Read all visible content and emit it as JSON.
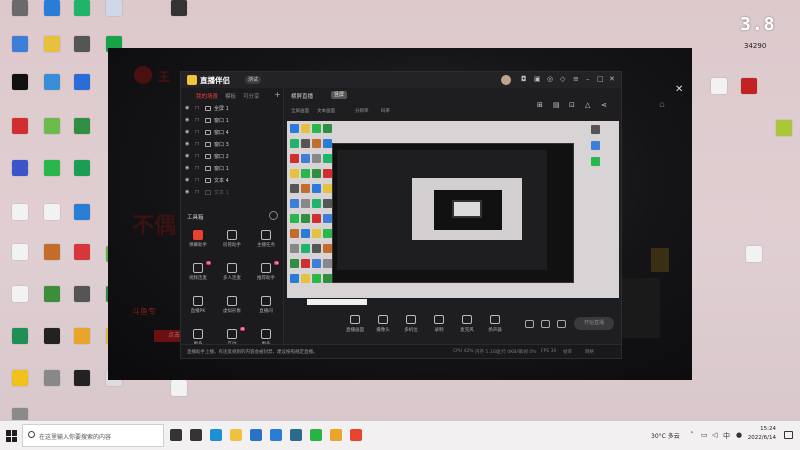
{
  "desktop_badge": {
    "big_text": "3.8",
    "small_text": "34290"
  },
  "desktop_icons": [
    {
      "label": "",
      "color": "#6a6a6a"
    },
    {
      "label": "",
      "color": "#2b7bd8"
    },
    {
      "label": "",
      "color": "#1fb46a"
    },
    {
      "label": "",
      "color": "#cfd8e6"
    },
    {
      "label": "",
      "color": "#333333"
    },
    {
      "label": "",
      "color": "#3d7ed9"
    },
    {
      "label": "",
      "color": "#e8c040"
    },
    {
      "label": "",
      "color": "#555555"
    },
    {
      "label": "",
      "color": "#17a34a"
    },
    {
      "label": "",
      "color": "#111111"
    },
    {
      "label": "",
      "color": "#3a8ed8"
    },
    {
      "label": "",
      "color": "#2b6cd8"
    },
    {
      "label": "",
      "color": "#d12f2f"
    },
    {
      "label": "",
      "color": "#6dbb4c"
    },
    {
      "label": "",
      "color": "#2f8e3f"
    },
    {
      "label": "",
      "color": "#3b55c8"
    },
    {
      "label": "",
      "color": "#29b64b"
    },
    {
      "label": "",
      "color": "#1a9e55"
    },
    {
      "label": "",
      "color": "#f2f2f2"
    },
    {
      "label": "",
      "color": "#f2f2f2"
    },
    {
      "label": "",
      "color": "#2a7fd4"
    },
    {
      "label": "",
      "color": "#f2f2f2"
    },
    {
      "label": "",
      "color": "#c26d2c"
    },
    {
      "label": "",
      "color": "#d7363b"
    },
    {
      "label": "",
      "color": "#f2f2f2"
    },
    {
      "label": "",
      "color": "#3d8e3a"
    },
    {
      "label": "",
      "color": "#555555"
    },
    {
      "label": "",
      "color": "#1f8f55"
    },
    {
      "label": "",
      "color": "#222222"
    },
    {
      "label": "",
      "color": "#e8a52a"
    },
    {
      "label": "",
      "color": "#2d8f3b"
    },
    {
      "label": "",
      "color": "#e8b440"
    },
    {
      "label": "",
      "color": "#5db24c"
    },
    {
      "label": "",
      "color": "#f1c21b"
    },
    {
      "label": "",
      "color": "#888888"
    },
    {
      "label": "",
      "color": "#222222"
    },
    {
      "label": "",
      "color": "#dddddd"
    },
    {
      "label": "",
      "color": "#f2f2f2"
    },
    {
      "label": "",
      "color": "#f2f2f2"
    },
    {
      "label": "",
      "color": "#c22222"
    },
    {
      "label": "",
      "color": "#a8c83a"
    },
    {
      "label": "",
      "color": "#f2f2f2"
    },
    {
      "label": "",
      "color": "#8a8a8a"
    }
  ],
  "overlay": {
    "close_icon": "close-icon",
    "big_text": "不偶",
    "red_text": "斗鱼专",
    "red_button": "点击"
  },
  "app": {
    "name": "直播伴侣",
    "version": "测试",
    "sidebar_tabs": [
      {
        "label": "我的场景",
        "active": true
      },
      {
        "label": "模板",
        "active": false
      },
      {
        "label": "可分享",
        "active": false
      }
    ],
    "scenes": [
      {
        "name": "全屏 1",
        "ghost": false
      },
      {
        "name": "窗口 1",
        "ghost": false
      },
      {
        "name": "窗口 4",
        "ghost": false
      },
      {
        "name": "窗口 3",
        "ghost": false
      },
      {
        "name": "窗口 2",
        "ghost": false
      },
      {
        "name": "窗口 1",
        "ghost": false
      },
      {
        "name": "文本 4",
        "ghost": false
      },
      {
        "name": "文本 1",
        "ghost": true
      }
    ],
    "tools_title": "工具箱",
    "tools": [
      {
        "label": "弹幕助手",
        "red": true,
        "new": false
      },
      {
        "label": "房管助手",
        "red": false,
        "new": false
      },
      {
        "label": "主播任务",
        "red": false,
        "new": false
      },
      {
        "label": "视频连麦",
        "red": false,
        "new": true
      },
      {
        "label": "多人连麦",
        "red": false,
        "new": false
      },
      {
        "label": "推荐助手",
        "red": false,
        "new": true
      },
      {
        "label": "直播PK",
        "red": false,
        "new": false
      },
      {
        "label": "虚拟形象",
        "red": false,
        "new": false
      },
      {
        "label": "直播间",
        "red": false,
        "new": false
      },
      {
        "label": "更多",
        "red": false,
        "new": false
      },
      {
        "label": "互动",
        "red": false,
        "new": true
      },
      {
        "label": "更多",
        "red": false,
        "new": false
      }
    ],
    "preview_tabs": [
      {
        "label": "横屏直播"
      },
      {
        "label": "竖屏"
      }
    ],
    "preview_sub": [
      "全屏画面",
      "文本画面",
      "分辨率",
      "码率"
    ],
    "controls": [
      {
        "label": "直播画面"
      },
      {
        "label": "摄像头"
      },
      {
        "label": "多机位"
      },
      {
        "label": "录制"
      },
      {
        "label": "麦克风"
      },
      {
        "label": "扬声器"
      }
    ],
    "start_button": "开始直播",
    "notice": "直播助手上播，有违反规则的内容会被封禁，建议按照规定直播。",
    "stats": [
      "CPU 42%",
      "内存 5.1GB",
      "上行 0KB/S",
      "丢帧 0%",
      "FPS 30",
      "帧率",
      "网络"
    ]
  },
  "taskbar": {
    "search_placeholder": "在这里输入你要搜索的内容",
    "apps": [
      {
        "name": "cortana-icon",
        "color": "#333333"
      },
      {
        "name": "task-view-icon",
        "color": "#333333"
      },
      {
        "name": "edge-icon",
        "color": "#1e8fd6"
      },
      {
        "name": "explorer-icon",
        "color": "#f0c040"
      },
      {
        "name": "store-icon",
        "color": "#2a72c8"
      },
      {
        "name": "mail-icon",
        "color": "#2a7dd6"
      },
      {
        "name": "vpn-icon",
        "color": "#2a6b8e"
      },
      {
        "name": "wechat-icon",
        "color": "#27b445"
      },
      {
        "name": "app-icon",
        "color": "#e8a52a"
      },
      {
        "name": "douyu-icon",
        "color": "#e8432e"
      }
    ],
    "weather": "30°C 多云",
    "time": "15:24",
    "date": "2022/6/14"
  }
}
